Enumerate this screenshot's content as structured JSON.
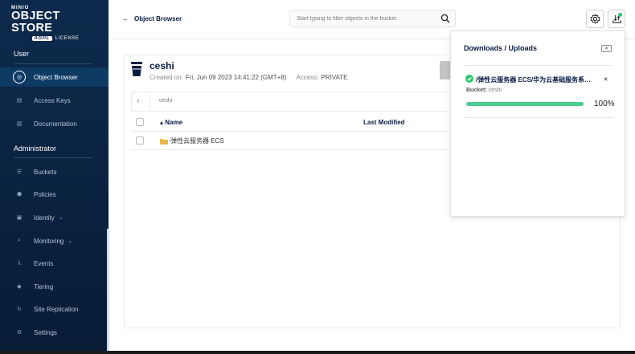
{
  "logo": {
    "brand": "MINIO",
    "product": "OBJECT STORE",
    "license_badge": "AGPL",
    "license_label": "LICENSE"
  },
  "sidebar": {
    "sections": [
      {
        "label": "User",
        "items": [
          {
            "label": "Object Browser",
            "icon": "object-browser-icon",
            "active": true
          },
          {
            "label": "Access Keys",
            "icon": "access-keys-icon"
          },
          {
            "label": "Documentation",
            "icon": "documentation-icon"
          }
        ]
      },
      {
        "label": "Administrator",
        "items": [
          {
            "label": "Buckets",
            "icon": "buckets-icon"
          },
          {
            "label": "Policies",
            "icon": "policies-icon"
          },
          {
            "label": "Identity",
            "icon": "identity-icon",
            "expandable": true
          },
          {
            "label": "Monitoring",
            "icon": "monitoring-icon",
            "expandable": true
          },
          {
            "label": "Events",
            "icon": "lambda-icon"
          },
          {
            "label": "Tiering",
            "icon": "tiering-icon"
          },
          {
            "label": "Site Replication",
            "icon": "replication-icon"
          },
          {
            "label": "Settings",
            "icon": "settings-icon"
          }
        ]
      }
    ]
  },
  "header": {
    "back_label": "Object Browser",
    "search_placeholder": "Start typing to filter objects in the bucket"
  },
  "bucket": {
    "name": "ceshi",
    "created_label": "Created on:",
    "created_value": "Fri, Jun 09 2023 14:41:22 (GMT+8)",
    "access_label": "Access:",
    "access_value": "PRIVATE",
    "path": "ceshi"
  },
  "table": {
    "columns": [
      "Name",
      "Last Modified"
    ],
    "rows": [
      {
        "name": "弹性云服务器 ECS",
        "type": "folder"
      }
    ]
  },
  "downloads": {
    "title": "Downloads / Uploads",
    "item": {
      "file": "/弹性云服务器 ECS/华为云基础服务系列...",
      "bucket_label": "Bucket:",
      "bucket_value": "ceshi",
      "progress": 100,
      "progress_label": "100%"
    }
  },
  "colors": {
    "sidebar": "#0d2a4c",
    "progress": "#4ccb8f",
    "success": "#2bc66e"
  }
}
